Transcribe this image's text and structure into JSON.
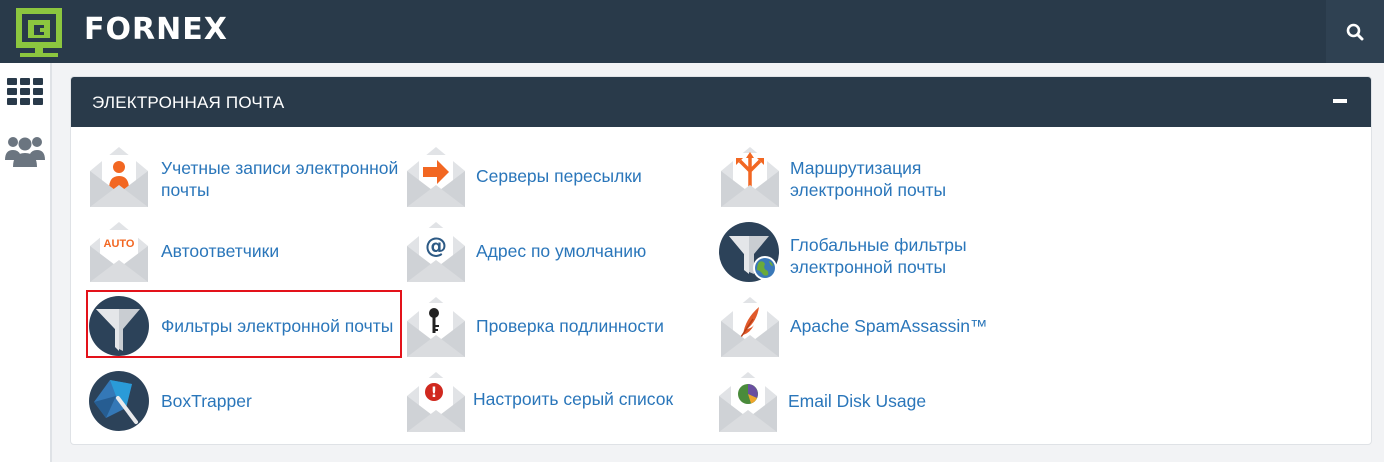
{
  "app": {
    "logo_text": "FORNEX"
  },
  "topbar": {
    "search_icon": "search-icon"
  },
  "sidebar": {
    "items": [
      {
        "icon": "grid-icon"
      },
      {
        "icon": "users-icon"
      }
    ]
  },
  "panel": {
    "title": "ЭЛЕКТРОННАЯ ПОЧТА",
    "items": [
      {
        "label": "Учетные записи электронной почты",
        "icon": "user-envelope-icon"
      },
      {
        "label": "Серверы пересылки",
        "icon": "forward-arrow-envelope-icon"
      },
      {
        "label": "Маршрутизация электронной почты",
        "icon": "routing-envelope-icon"
      },
      {
        "label": "Автоответчики",
        "icon": "auto-envelope-icon",
        "badge": "AUTO"
      },
      {
        "label": "Адрес по умолчанию",
        "icon": "at-envelope-icon",
        "badge": "@"
      },
      {
        "label": "Глобальные фильтры электронной почты",
        "icon": "global-filter-icon"
      },
      {
        "label": "Фильтры электронной почты",
        "icon": "filter-icon"
      },
      {
        "label": "Проверка подлинности",
        "icon": "key-envelope-icon"
      },
      {
        "label": "Apache SpamAssassin™",
        "icon": "feather-envelope-icon"
      },
      {
        "label": "BoxTrapper",
        "icon": "boxtrapper-icon"
      },
      {
        "label": "Настроить серый список",
        "icon": "alert-envelope-icon",
        "badge": "!"
      },
      {
        "label": "Email Disk Usage",
        "icon": "pie-envelope-icon"
      }
    ]
  },
  "colors": {
    "header": "#293a4a",
    "link": "#2a76ba",
    "highlight": "#e3121a",
    "accent_orange": "#f26722",
    "logo_green": "#8cc63f"
  }
}
